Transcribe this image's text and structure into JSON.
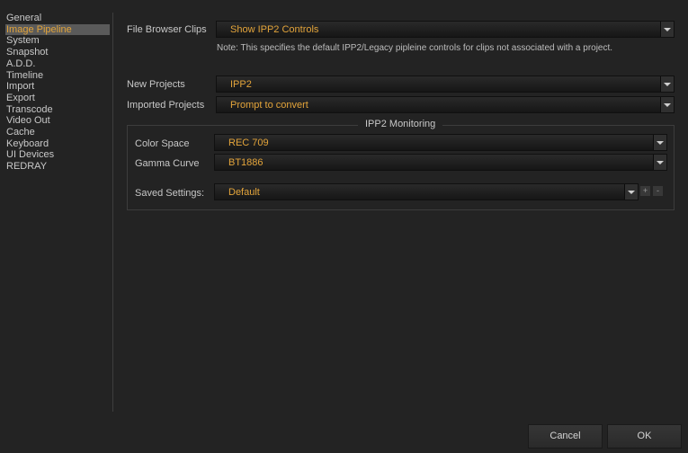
{
  "sidebar": {
    "items": [
      {
        "label": "General"
      },
      {
        "label": "Image Pipeline",
        "selected": true
      },
      {
        "label": "System"
      },
      {
        "label": "Snapshot"
      },
      {
        "label": "A.D.D."
      },
      {
        "label": "Timeline"
      },
      {
        "label": "Import"
      },
      {
        "label": "Export"
      },
      {
        "label": "Transcode"
      },
      {
        "label": "Video Out"
      },
      {
        "label": "Cache"
      },
      {
        "label": "Keyboard"
      },
      {
        "label": "UI Devices"
      },
      {
        "label": "REDRAY"
      }
    ]
  },
  "settings": {
    "file_browser_clips": {
      "label": "File Browser Clips",
      "value": "Show IPP2 Controls"
    },
    "note": "Note: This specifies the default IPP2/Legacy pipleine controls for clips not associated with a project.",
    "new_projects": {
      "label": "New Projects",
      "value": "IPP2"
    },
    "imported_projects": {
      "label": "Imported Projects",
      "value": "Prompt to convert"
    }
  },
  "monitoring": {
    "title": "IPP2 Monitoring",
    "color_space": {
      "label": "Color Space",
      "value": "REC 709"
    },
    "gamma_curve": {
      "label": "Gamma Curve",
      "value": "BT1886"
    },
    "saved_settings": {
      "label": "Saved Settings:",
      "value": "Default",
      "add_label": "+",
      "remove_label": "-"
    }
  },
  "buttons": {
    "cancel": "Cancel",
    "ok": "OK"
  },
  "colors": {
    "accent": "#e3a43a",
    "background": "#232323",
    "selected_bg": "#5a5a5a"
  }
}
